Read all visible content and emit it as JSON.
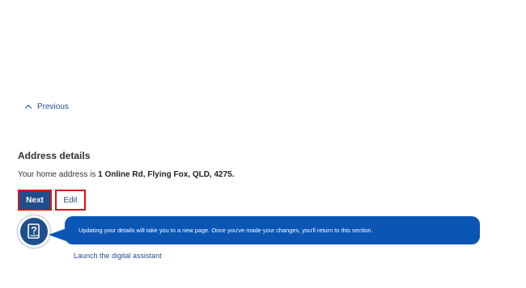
{
  "navigation": {
    "previous_label": "Previous"
  },
  "address": {
    "section_title": "Address details",
    "prefix_text": "Your home address is",
    "value": "1 Online Rd, Flying Fox, QLD, 4275."
  },
  "actions": {
    "next_label": "Next",
    "edit_label": "Edit"
  },
  "assistant": {
    "avatar_icon": "question-book-icon",
    "message": "Updating your details will take you to a new page. Once you've made your changes, you'll return to this section.",
    "launch_label": "Launch the digital assistant"
  },
  "colors": {
    "primary": "#1f4e8c",
    "bubble": "#0b55b5",
    "highlight_border": "#d7141a",
    "text": "#333333"
  }
}
